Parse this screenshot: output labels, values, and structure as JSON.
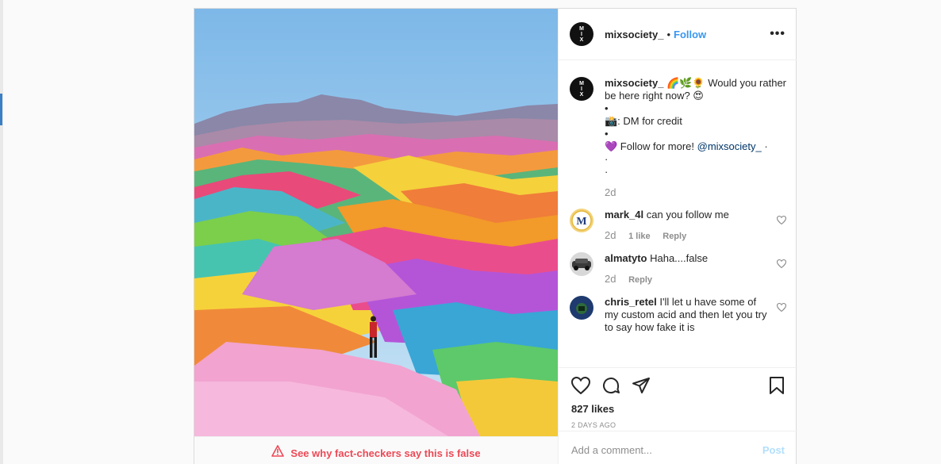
{
  "post": {
    "username": "mixsociety_",
    "follow_label": "Follow",
    "header_dot": "•",
    "more_label": "•••",
    "avatar_text": [
      "M",
      "I",
      "X"
    ],
    "caption": {
      "username": "mixsociety_",
      "emojis": "🌈🌿🌻",
      "line1": "Would you rather be here right now? 😍",
      "line2": "•",
      "line3": "📸: DM for credit",
      "line4": "•",
      "line5_prefix": "💜 Follow for more!",
      "line5_mention": "@mixsociety_",
      "line5_suffix": "·",
      "line6": "·",
      "line7": "·",
      "time": "2d"
    },
    "comments": [
      {
        "username": "mark_4l",
        "text": "can you follow me",
        "time": "2d",
        "likes": "1 like",
        "reply": "Reply"
      },
      {
        "username": "almatyto",
        "text": "Haha....false",
        "time": "2d",
        "reply": "Reply"
      },
      {
        "username": "chris_retel",
        "text": "I'll let u have some of my custom acid and then let you try to say how fake it is"
      }
    ],
    "likes": "827 likes",
    "posted_ago": "2 DAYS AGO",
    "add_comment_placeholder": "Add a comment...",
    "post_button": "Post",
    "fact_check": "See why fact-checkers say this is false"
  },
  "colors": {
    "follow": "#3897f0",
    "fact_check": "#ed4956",
    "post_button_disabled": "#b2dffc",
    "mention": "#003569"
  },
  "icons": [
    "heart-icon",
    "comment-icon",
    "share-icon",
    "bookmark-icon",
    "warning-icon",
    "more-options-icon"
  ]
}
